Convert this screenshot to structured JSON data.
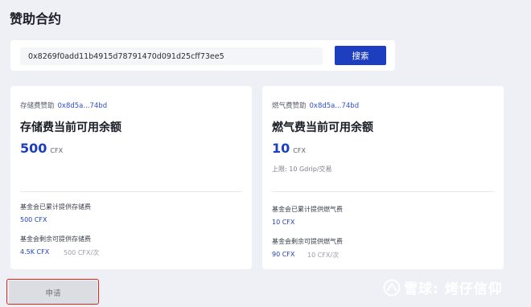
{
  "page": {
    "title": "赞助合约"
  },
  "search": {
    "value": "0x8269f0add11b4915d78791470d091d25cff73ee5",
    "button_label": "搜索"
  },
  "storage_card": {
    "label": "存储费赞助",
    "address": "0x8d5a...74bd",
    "title": "存储费当前可用余额",
    "amount": "500",
    "unit": "CFX",
    "total_label": "基金会已累计提供存储费",
    "total_value": "500 CFX",
    "remaining_label": "基金会剩余可提供存储费",
    "remaining_value": "4.5K CFX",
    "per_tx": "500 CFX/次"
  },
  "gas_card": {
    "label": "燃气费赞助",
    "address": "0x8d5a...74bd",
    "title": "燃气费当前可用余额",
    "amount": "10",
    "unit": "CFX",
    "limit": "上限: 10 Gdrip/交易",
    "total_label": "基金会已累计提供燃气费",
    "total_value": "10 CFX",
    "remaining_label": "基金会剩余可提供燃气费",
    "remaining_value": "90 CFX",
    "per_tx": "10 CFX/次"
  },
  "apply": {
    "label": "申请"
  },
  "watermark": {
    "text": "雪球: 烤仔信仰"
  },
  "colors": {
    "accent": "#1d3fbf",
    "link": "#2c4fd1",
    "highlight_border": "#d9261c"
  }
}
